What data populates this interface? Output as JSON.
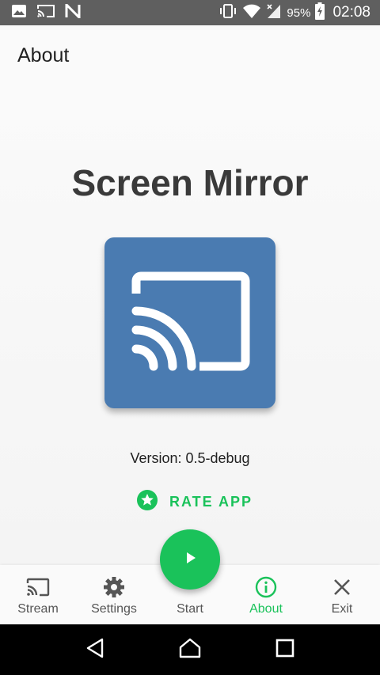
{
  "status_bar": {
    "battery": "95%",
    "time": "02:08",
    "icons": [
      "image-icon",
      "cast-icon",
      "n-icon",
      "vibrate-icon",
      "wifi-icon",
      "signal-icon",
      "battery-charging-icon"
    ]
  },
  "app_bar": {
    "title": "About"
  },
  "main": {
    "app_name": "Screen Mirror",
    "app_icon": "cast-icon",
    "version": "Version: 0.5-debug",
    "rate_label": "RATE APP",
    "rate_icon": "star-icon"
  },
  "bottom_nav": {
    "items": [
      {
        "label": "Stream",
        "icon": "cast-icon",
        "active": false
      },
      {
        "label": "Settings",
        "icon": "gear-icon",
        "active": false
      },
      {
        "label": "Start",
        "icon": "play-icon",
        "active": false
      },
      {
        "label": "About",
        "icon": "info-icon",
        "active": true
      },
      {
        "label": "Exit",
        "icon": "close-icon",
        "active": false
      }
    ]
  },
  "colors": {
    "accent": "#1ac25a",
    "icon_blue": "#4a7bb1",
    "status_bar": "#5f5f5f",
    "system_nav": "#000000"
  }
}
